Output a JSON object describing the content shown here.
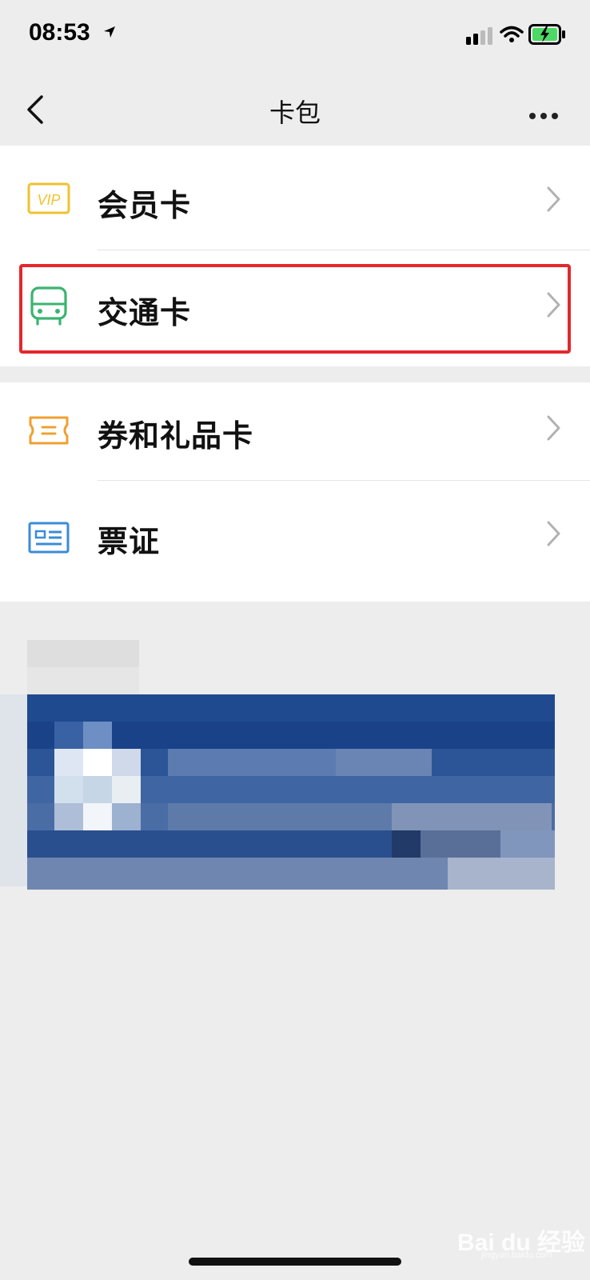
{
  "status_bar": {
    "time": "08:53"
  },
  "nav": {
    "title": "卡包"
  },
  "menu": {
    "member_card": {
      "label": "会员卡",
      "icon": "vip-icon",
      "color": "#f2c12e"
    },
    "transit_card": {
      "label": "交通卡",
      "icon": "bus-icon",
      "color": "#3cb371"
    },
    "coupons": {
      "label": "券和礼品卡",
      "icon": "ticket-icon",
      "color": "#f0a030"
    },
    "tickets": {
      "label": "票证",
      "icon": "id-card-icon",
      "color": "#3b8bd9"
    }
  },
  "highlight_color": "#e3282d",
  "watermark": {
    "text": "Bai du 经验",
    "sub": "jingyan.baidu.com"
  }
}
